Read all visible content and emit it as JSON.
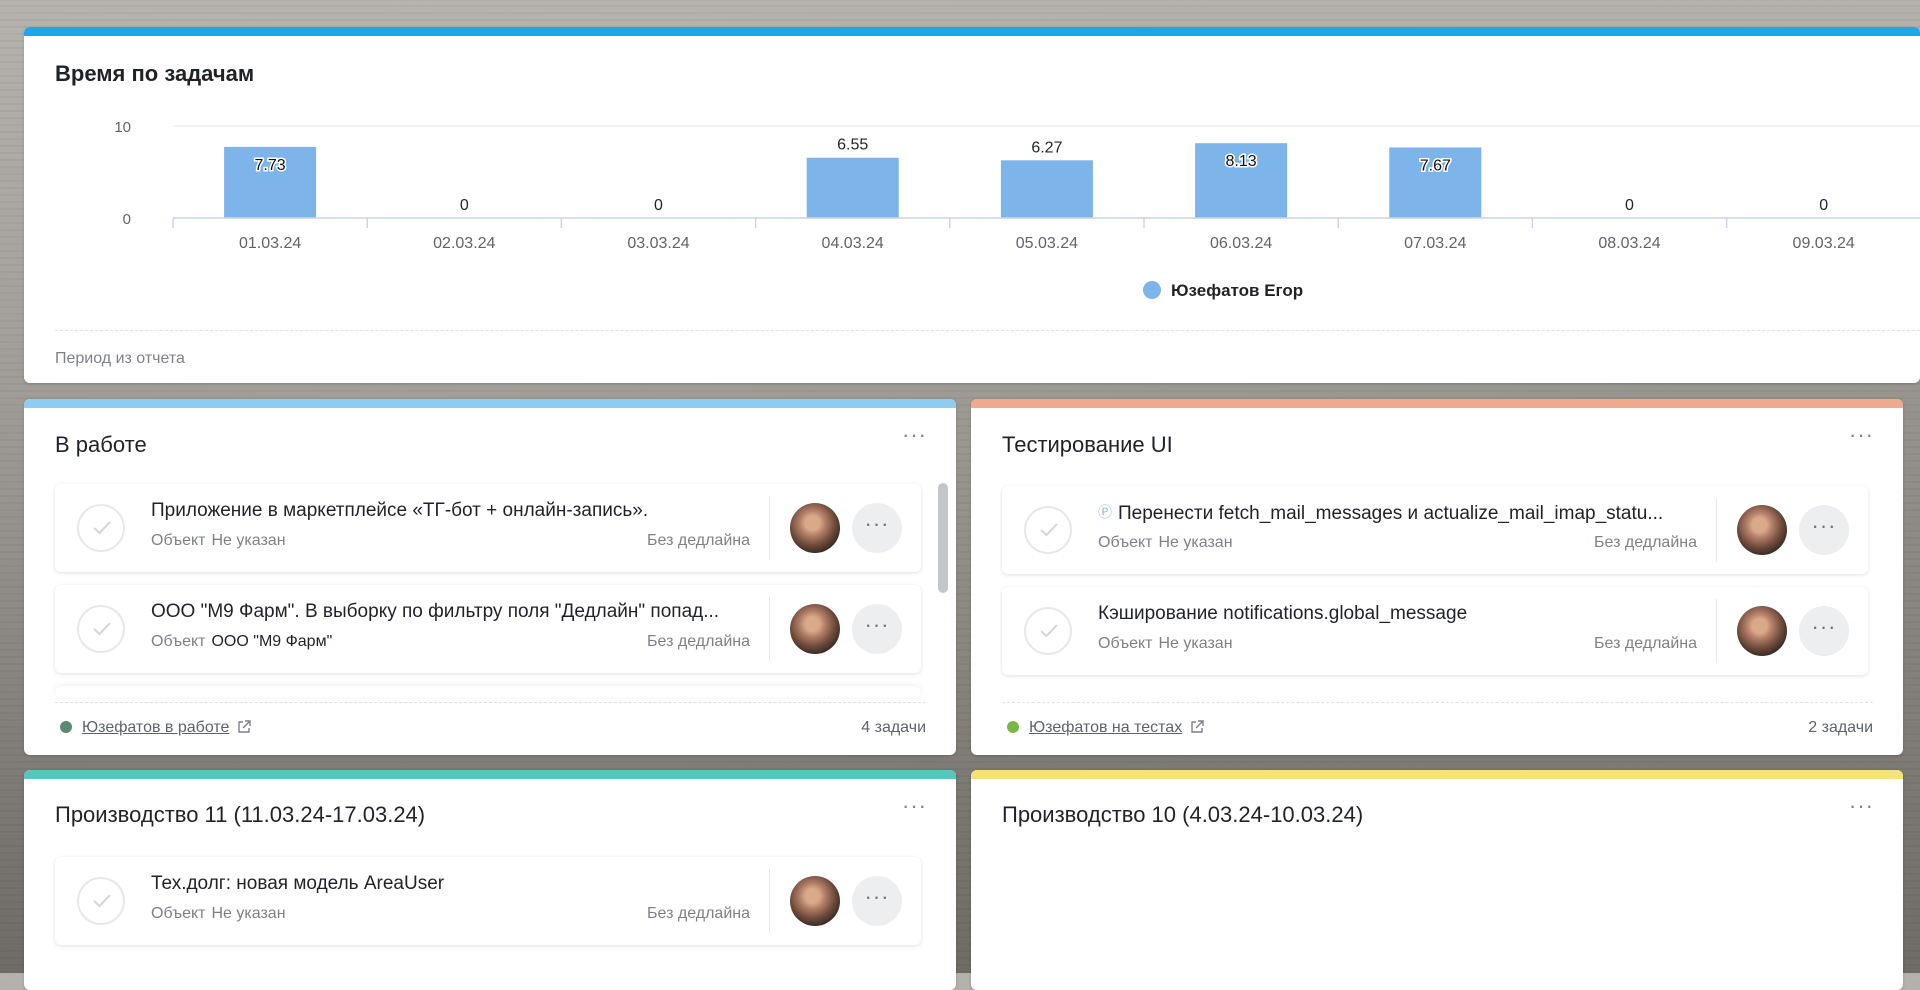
{
  "colors": {
    "blue_bar": "#1da6e8",
    "light_blue_bar": "#8fcdf0",
    "salmon_bar": "#efa98f",
    "teal_bar": "#56c7bc",
    "yellow_bar": "#f5e27a",
    "chart_bar": "#7db4ea",
    "status_gray_green": "#5b8a77",
    "status_green": "#7ab648"
  },
  "chart_card": {
    "title": "Время по задачам",
    "footer_note": "Период из отчета"
  },
  "chart_data": {
    "type": "bar",
    "categories": [
      "01.03.24",
      "02.03.24",
      "03.03.24",
      "04.03.24",
      "05.03.24",
      "06.03.24",
      "07.03.24",
      "08.03.24",
      "09.03.24"
    ],
    "series": [
      {
        "name": "Юзефатов Егор",
        "values": [
          7.73,
          0,
          0,
          6.55,
          6.27,
          8.13,
          7.67,
          0,
          0
        ]
      }
    ],
    "value_labels": [
      "7.73",
      "0",
      "0",
      "6.55",
      "6.27",
      "8.13",
      "7.67",
      "0",
      "0"
    ],
    "yticks": [
      "10",
      "0"
    ],
    "ylim": [
      0,
      10
    ],
    "grid": true,
    "legend_position": "bottom"
  },
  "in_work": {
    "title": "В работе",
    "tasks": [
      {
        "title": "Приложение в маркетплейсе «ТГ-бот + онлайн-запись».",
        "object_label": "Объект",
        "object_value": "Не указан",
        "deadline": "Без дедлайна"
      },
      {
        "title": "ООО \"М9 Фарм\". В выборку по фильтру поля \"Дедлайн\" попад...",
        "object_label": "Объект",
        "object_value": "ООО \"М9 Фарм\"",
        "deadline": "Без дедлайна"
      }
    ],
    "footer_link": "Юзефатов в работе",
    "footer_count": "4 задачи"
  },
  "testing_ui": {
    "title": "Тестирование UI",
    "tasks": [
      {
        "title": "Перенести fetch_mail_messages и actualize_mail_imap_statu...",
        "object_label": "Объект",
        "object_value": "Не указан",
        "deadline": "Без дедлайна"
      },
      {
        "title": "Кэширование notifications.global_message",
        "object_label": "Объект",
        "object_value": "Не указан",
        "deadline": "Без дедлайна"
      }
    ],
    "footer_link": "Юзефатов на тестах",
    "footer_count": "2 задачи"
  },
  "production_11": {
    "title": "Производство 11 (11.03.24-17.03.24)",
    "tasks": [
      {
        "title": "Тех.долг: новая модель AreaUser",
        "object_label": "Объект",
        "object_value": "Не указан",
        "deadline": "Без дедлайна"
      }
    ]
  },
  "production_10": {
    "title": "Производство 10 (4.03.24-10.03.24)"
  },
  "icons": {
    "more": "ellipsis-icon",
    "check": "checkmark-icon",
    "external": "external-link-icon",
    "task_type": "task-type-icon"
  }
}
